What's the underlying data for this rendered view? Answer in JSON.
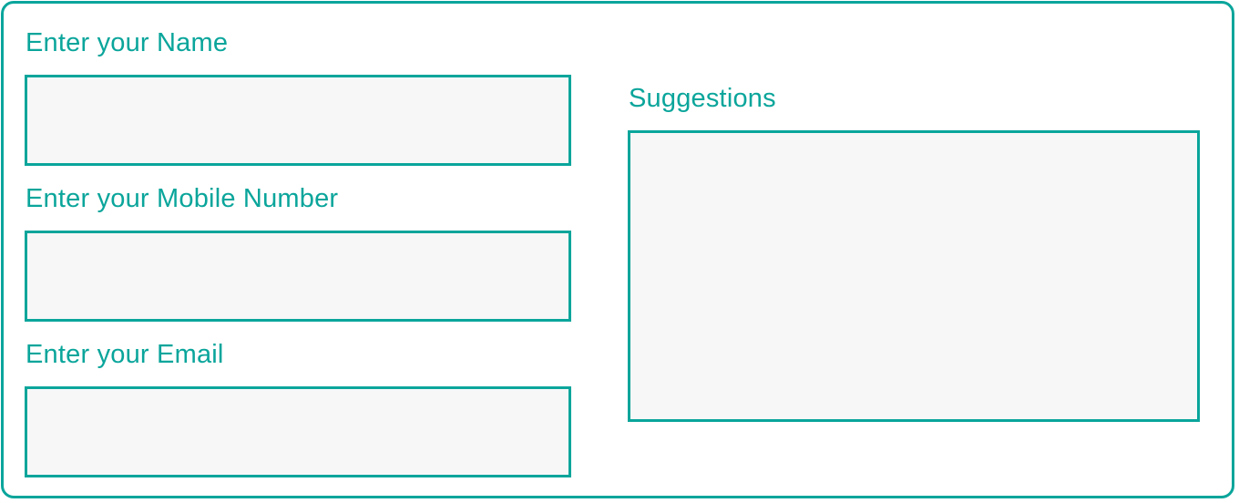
{
  "form": {
    "name": {
      "label": "Enter your Name",
      "value": "",
      "placeholder": ""
    },
    "mobile": {
      "label": "Enter your Mobile Number",
      "value": "",
      "placeholder": ""
    },
    "email": {
      "label": "Enter your Email",
      "value": "",
      "placeholder": ""
    },
    "suggestions": {
      "label": "Suggestions",
      "value": "",
      "placeholder": ""
    }
  },
  "colors": {
    "accent": "#0aa59b",
    "field_background": "#f7f7f7",
    "page_background": "#ffffff"
  }
}
